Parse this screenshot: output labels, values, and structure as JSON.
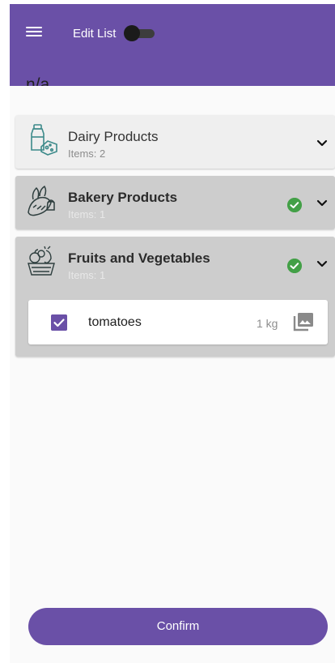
{
  "header": {
    "edit_list_label": "Edit List",
    "edit_list_enabled": true,
    "subtitle": "n/a"
  },
  "categories": [
    {
      "name": "Dairy Products",
      "items_count": "Items: 2",
      "icon": "milk-cheese-icon",
      "completed": false,
      "expanded": false
    },
    {
      "name": "Bakery Products",
      "items_count": "Items: 1",
      "icon": "bread-icon",
      "completed": true,
      "expanded": false
    },
    {
      "name": "Fruits and Vegetables",
      "items_count": "Items: 1",
      "icon": "fruit-basket-icon",
      "completed": true,
      "expanded": true
    }
  ],
  "items": [
    {
      "name": "tomatoes",
      "quantity": "1 kg",
      "checked": true
    }
  ],
  "footer": {
    "confirm_label": "Confirm"
  },
  "colors": {
    "primary": "#6a50a7",
    "success": "#43a047",
    "icon_teal": "#3c8a8a"
  }
}
